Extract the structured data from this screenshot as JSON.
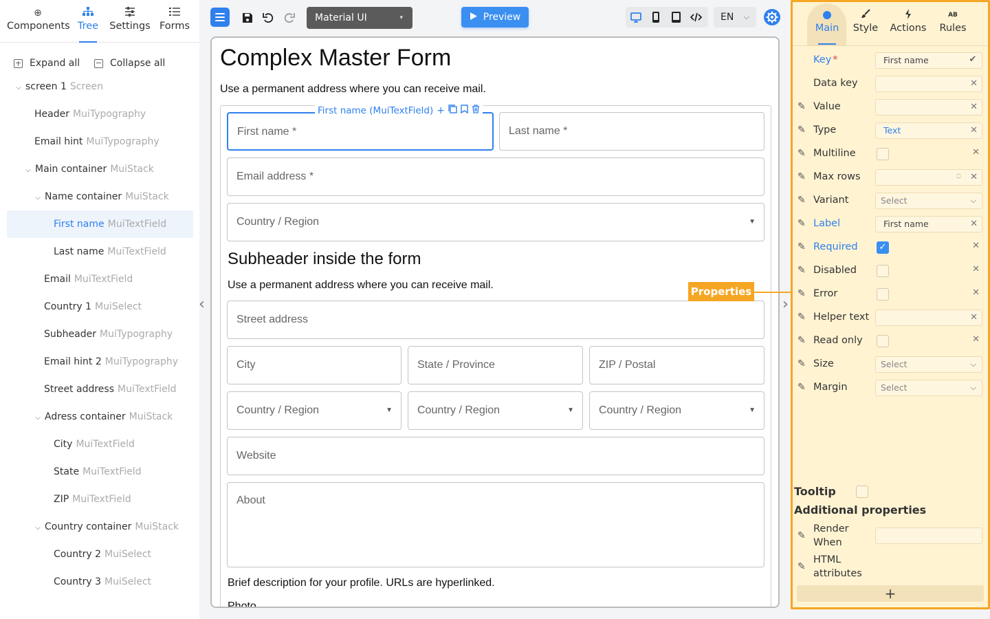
{
  "left_tabs": [
    {
      "label": "Components",
      "icon": "plus-circle-icon",
      "glyph": "⊕"
    },
    {
      "label": "Tree",
      "icon": "tree-icon",
      "glyph": "⋮"
    },
    {
      "label": "Settings",
      "icon": "sliders-icon",
      "glyph": "☰"
    },
    {
      "label": "Forms",
      "icon": "list-icon",
      "glyph": "☷"
    }
  ],
  "expand_all": "Expand all",
  "collapse_all": "Collapse all",
  "tree": [
    {
      "name": "screen 1",
      "type": "Screen",
      "chevron": "⌵"
    },
    {
      "name": "Header",
      "type": "MuiTypography"
    },
    {
      "name": "Email hint",
      "type": "MuiTypography"
    },
    {
      "name": "Main container",
      "type": "MuiStack",
      "chevron": "⌵"
    },
    {
      "name": "Name container",
      "type": "MuiStack",
      "chevron": "⌵"
    },
    {
      "name": "First name",
      "type": "MuiTextField",
      "selected": true
    },
    {
      "name": "Last name",
      "type": "MuiTextField"
    },
    {
      "name": "Email",
      "type": "MuiTextField"
    },
    {
      "name": "Country 1",
      "type": "MuiSelect"
    },
    {
      "name": "Subheader",
      "type": "MuiTypography"
    },
    {
      "name": "Email hint 2",
      "type": "MuiTypography"
    },
    {
      "name": "Street address",
      "type": "MuiTextField"
    },
    {
      "name": "Adress container",
      "type": "MuiStack",
      "chevron": "⌵"
    },
    {
      "name": "City",
      "type": "MuiTextField"
    },
    {
      "name": "State",
      "type": "MuiTextField"
    },
    {
      "name": "ZIP",
      "type": "MuiTextField"
    },
    {
      "name": "Country container",
      "type": "MuiStack",
      "chevron": "⌵"
    },
    {
      "name": "Country 2",
      "type": "MuiSelect"
    },
    {
      "name": "Country 3",
      "type": "MuiSelect"
    }
  ],
  "toolbar": {
    "theme": "Material UI",
    "preview": "Preview",
    "language": "EN"
  },
  "canvas": {
    "title": "Complex Master Form",
    "hint": "Use a permanent address where you can receive mail.",
    "selected_label": "First name (MuiTextField)",
    "fields": {
      "first_name": "First name *",
      "last_name": "Last name *",
      "email": "Email address *",
      "country1": "Country / Region",
      "street": "Street address",
      "city": "City",
      "state": "State / Province",
      "zip": "ZIP / Postal",
      "country2": "Country / Region",
      "country3": "Country / Region",
      "country4": "Country / Region",
      "website": "Website",
      "about": "About"
    },
    "subheader": "Subheader inside the form",
    "hint2": "Use a permanent address where you can receive mail.",
    "about_help": "Brief description for your profile. URLs are hyperlinked.",
    "photo": "Photo"
  },
  "properties_badge": "Properties",
  "right_tabs": [
    {
      "label": "Main",
      "icon": "dot-icon"
    },
    {
      "label": "Style",
      "icon": "brush-icon",
      "glyph": "✎"
    },
    {
      "label": "Actions",
      "icon": "bolt-icon",
      "glyph": "ϟ"
    },
    {
      "label": "Rules",
      "icon": "rules-icon",
      "glyph": "ᴬᴮ"
    }
  ],
  "props": {
    "key_label": "Key",
    "key_value": "First name",
    "data_key_label": "Data key",
    "value_label": "Value",
    "type_label": "Type",
    "type_value": "Text",
    "multiline_label": "Multiline",
    "max_rows_label": "Max rows",
    "variant_label": "Variant",
    "variant_value": "Select",
    "label_label": "Label",
    "label_value": "First name",
    "required_label": "Required",
    "disabled_label": "Disabled",
    "error_label": "Error",
    "helper_label": "Helper text",
    "readonly_label": "Read only",
    "size_label": "Size",
    "size_value": "Select",
    "margin_label": "Margin",
    "margin_value": "Select",
    "tooltip": "Tooltip",
    "additional": "Additional properties",
    "render_when": "Render When",
    "html_attributes": "HTML attributes"
  },
  "colors": {
    "accent": "#2f80ed",
    "properties": "#f5a623",
    "panel": "#fff3d2"
  }
}
